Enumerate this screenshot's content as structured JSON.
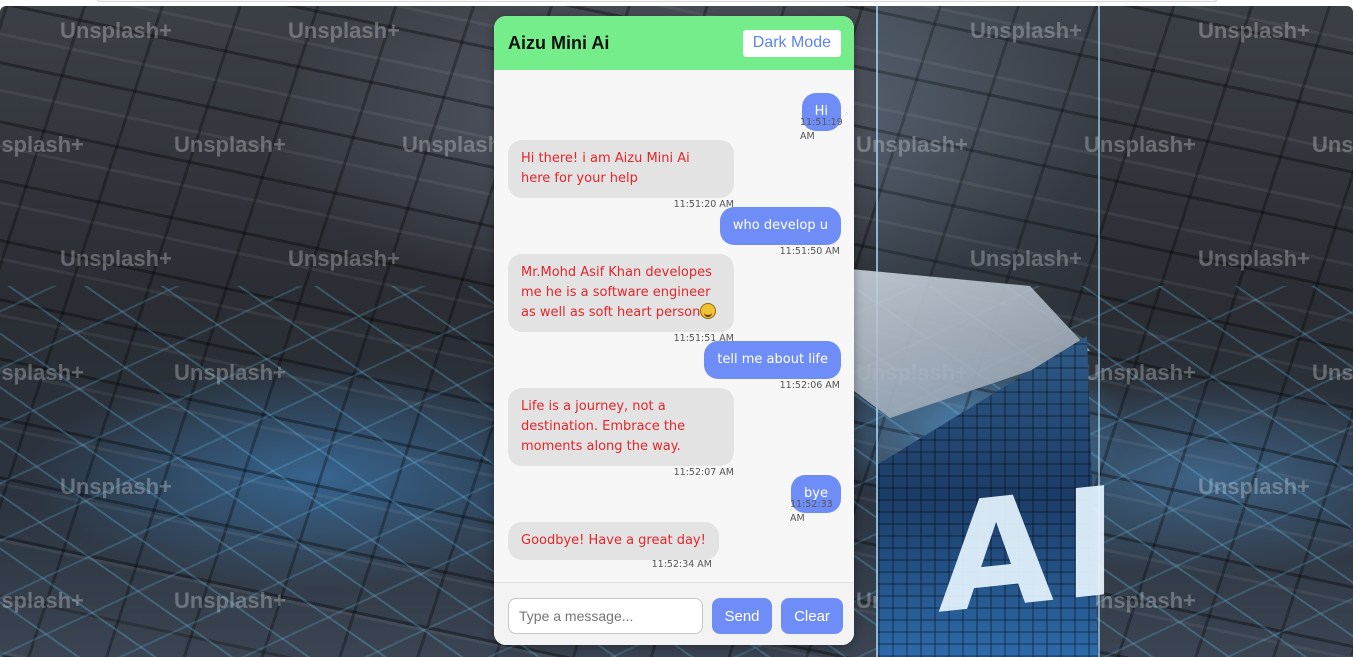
{
  "background": {
    "watermark_text": "Unsplash+",
    "cube_text": "AI"
  },
  "chat": {
    "title": "Aizu Mini Ai",
    "mode_button": "Dark Mode",
    "messages": [
      {
        "sender": "user",
        "text": "Hi",
        "time": "11:51:19 AM"
      },
      {
        "sender": "bot",
        "text": "Hi there! i am Aizu Mini Ai here for your help",
        "time": "11:51:20 AM"
      },
      {
        "sender": "user",
        "text": "who develop u",
        "time": "11:51:50 AM"
      },
      {
        "sender": "bot",
        "text": "Mr.Mohd Asif Khan developes me he is a software engineer as well as soft heart person",
        "time": "11:51:51 AM"
      },
      {
        "sender": "user",
        "text": "tell me about life",
        "time": "11:52:06 AM"
      },
      {
        "sender": "bot",
        "text": "Life is a journey, not a destination. Embrace the moments along the way.",
        "time": "11:52:07 AM"
      },
      {
        "sender": "user",
        "text": "bye",
        "time": "11:52:33 AM"
      },
      {
        "sender": "bot",
        "text": "Goodbye! Have a great day!",
        "time": "11:52:34 AM"
      }
    ],
    "input": {
      "placeholder": "Type a message...",
      "value": ""
    },
    "send_button": "Send",
    "clear_button": "Clear"
  },
  "colors": {
    "header": "#74ed8a",
    "user_bubble": "#6f8df7",
    "bot_bubble": "#e3e3e3",
    "bot_text": "#e3262c",
    "accent": "#6f8df7"
  }
}
